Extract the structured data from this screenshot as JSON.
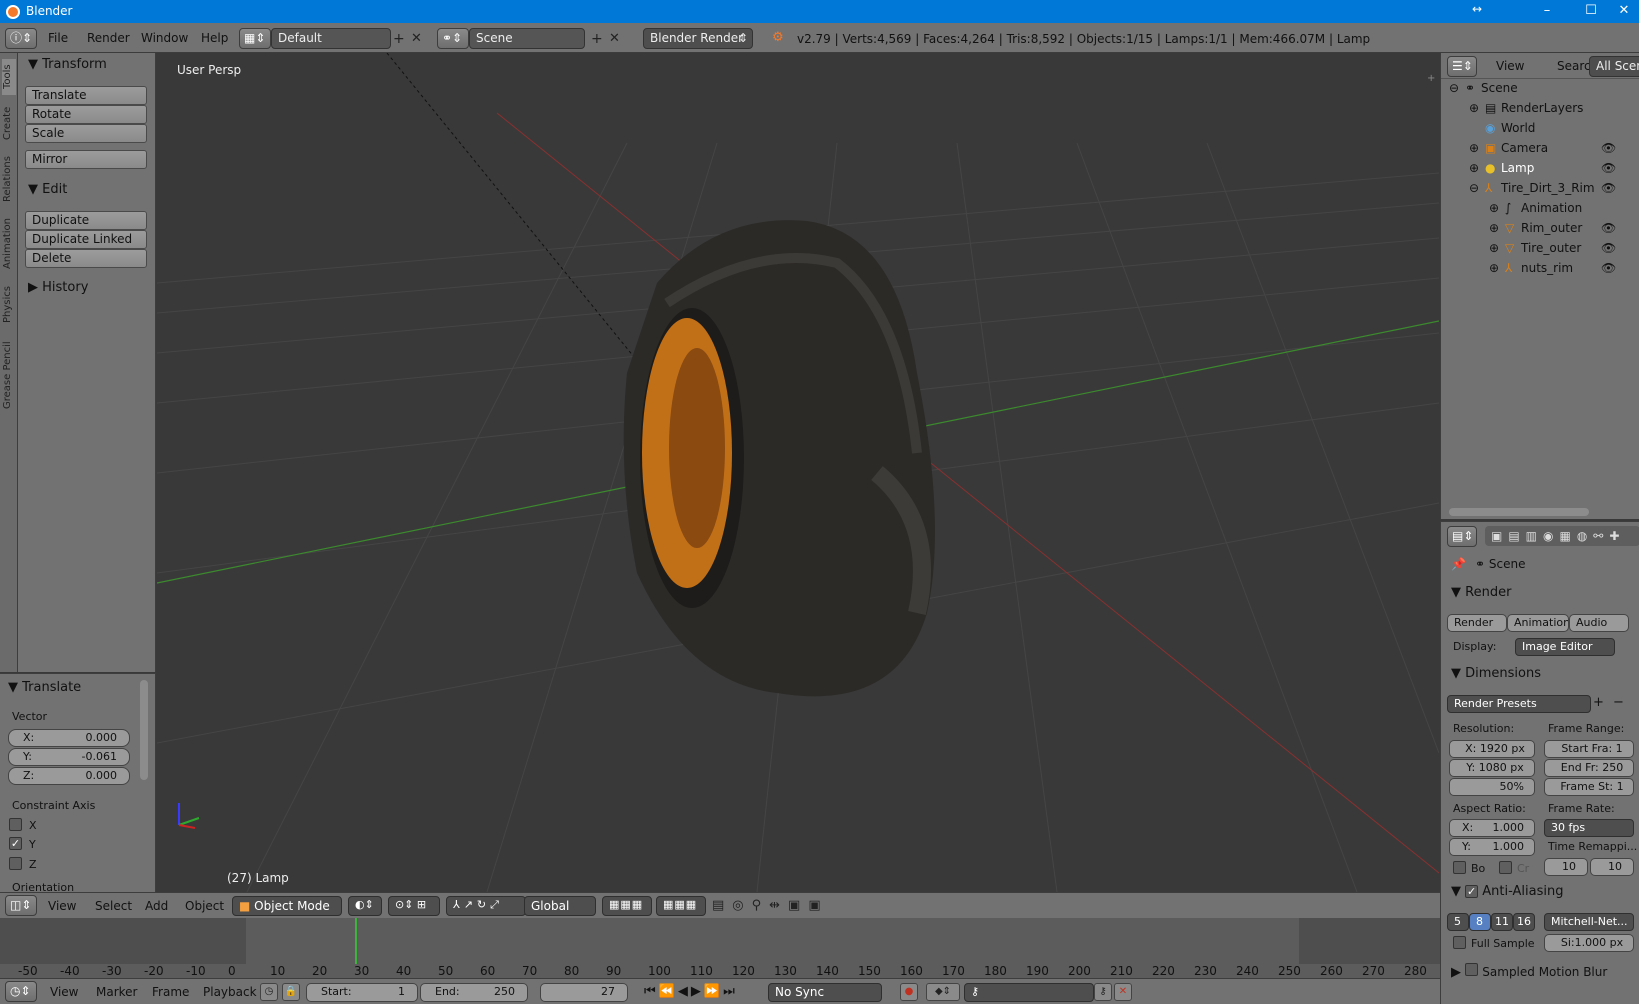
{
  "window": {
    "title": "Blender",
    "min": "–",
    "max": "☐",
    "close": "✕"
  },
  "infobar": {
    "menus": [
      "File",
      "Render",
      "Window",
      "Help"
    ],
    "layout": "Default",
    "scene": "Scene",
    "engine": "Blender Render",
    "stats": "v2.79 | Verts:4,569 | Faces:4,264 | Tris:8,592 | Objects:1/15 | Lamps:1/1 | Mem:466.07M | Lamp"
  },
  "tabs": [
    "Tools",
    "Create",
    "Relations",
    "Animation",
    "Physics",
    "Grease Pencil"
  ],
  "toolshelf": {
    "transform": "Transform",
    "translate": "Translate",
    "rotate": "Rotate",
    "scale": "Scale",
    "mirror": "Mirror",
    "edit": "Edit",
    "duplicate": "Duplicate",
    "duplicate_linked": "Duplicate Linked",
    "delete": "Delete",
    "history": "History"
  },
  "operator": {
    "title": "Translate",
    "vector": "Vector",
    "x_label": "X:",
    "x": "0.000",
    "y_label": "Y:",
    "y": "-0.061",
    "z_label": "Z:",
    "z": "0.000",
    "constraint": "Constraint Axis",
    "cx": "X",
    "cy": "Y",
    "cz": "Z",
    "orientation": "Orientation"
  },
  "viewport": {
    "label": "User Persp",
    "object": "(27) Lamp"
  },
  "outliner": {
    "view": "View",
    "search": "Search",
    "scenes": "All Scenes",
    "items": [
      "Scene",
      "RenderLayers",
      "World",
      "Camera",
      "Lamp",
      "Tire_Dirt_3_Rim",
      "Animation",
      "Rim_outer",
      "Tire_outer",
      "nuts_rim"
    ]
  },
  "properties": {
    "scene": "Scene",
    "render": "Render",
    "render_btn": "Render",
    "anim_btn": "Animation",
    "audio_btn": "Audio",
    "display_label": "Display:",
    "display": "Image Editor",
    "dimensions": "Dimensions",
    "presets": "Render Presets",
    "resolution": "Resolution:",
    "res_x": "X: 1920 px",
    "res_y": "Y: 1080 px",
    "res_pct": "50%",
    "frame_range": "Frame Range:",
    "start": "Start Fra: 1",
    "end": "End Fr: 250",
    "step": "Frame St: 1",
    "aspect": "Aspect Ratio:",
    "asp_x": "X:",
    "asp_x_val": "1.000",
    "asp_y": "Y:",
    "asp_y_val": "1.000",
    "frame_rate": "Frame Rate:",
    "fps": "30 fps",
    "remap": "Time Remappi...",
    "remap_old": "10",
    "remap_new": "10",
    "border": "Bo",
    "crop": "Cr",
    "aa": "Anti-Aliasing",
    "aa_5": "5",
    "aa_8": "8",
    "aa_11": "11",
    "aa_16": "16",
    "filter": "Mitchell-Net...",
    "full_sample": "Full Sample",
    "filter_size": "Si:1.000 px",
    "motion_blur": "Sampled Motion Blur"
  },
  "viewheader": {
    "view": "View",
    "select": "Select",
    "add": "Add",
    "object": "Object",
    "mode": "Object Mode",
    "orientation": "Global"
  },
  "timeline": {
    "ticks": [
      "-50",
      "-40",
      "-30",
      "-20",
      "-10",
      "0",
      "10",
      "20",
      "30",
      "40",
      "50",
      "60",
      "70",
      "80",
      "90",
      "100",
      "110",
      "120",
      "130",
      "140",
      "150",
      "160",
      "170",
      "180",
      "190",
      "200",
      "210",
      "220",
      "230",
      "240",
      "250",
      "260",
      "270",
      "280"
    ],
    "view": "View",
    "marker": "Marker",
    "frame": "Frame",
    "playback": "Playback",
    "start_label": "Start:",
    "start": "1",
    "end_label": "End:",
    "end": "250",
    "current": "27",
    "sync": "No Sync"
  }
}
